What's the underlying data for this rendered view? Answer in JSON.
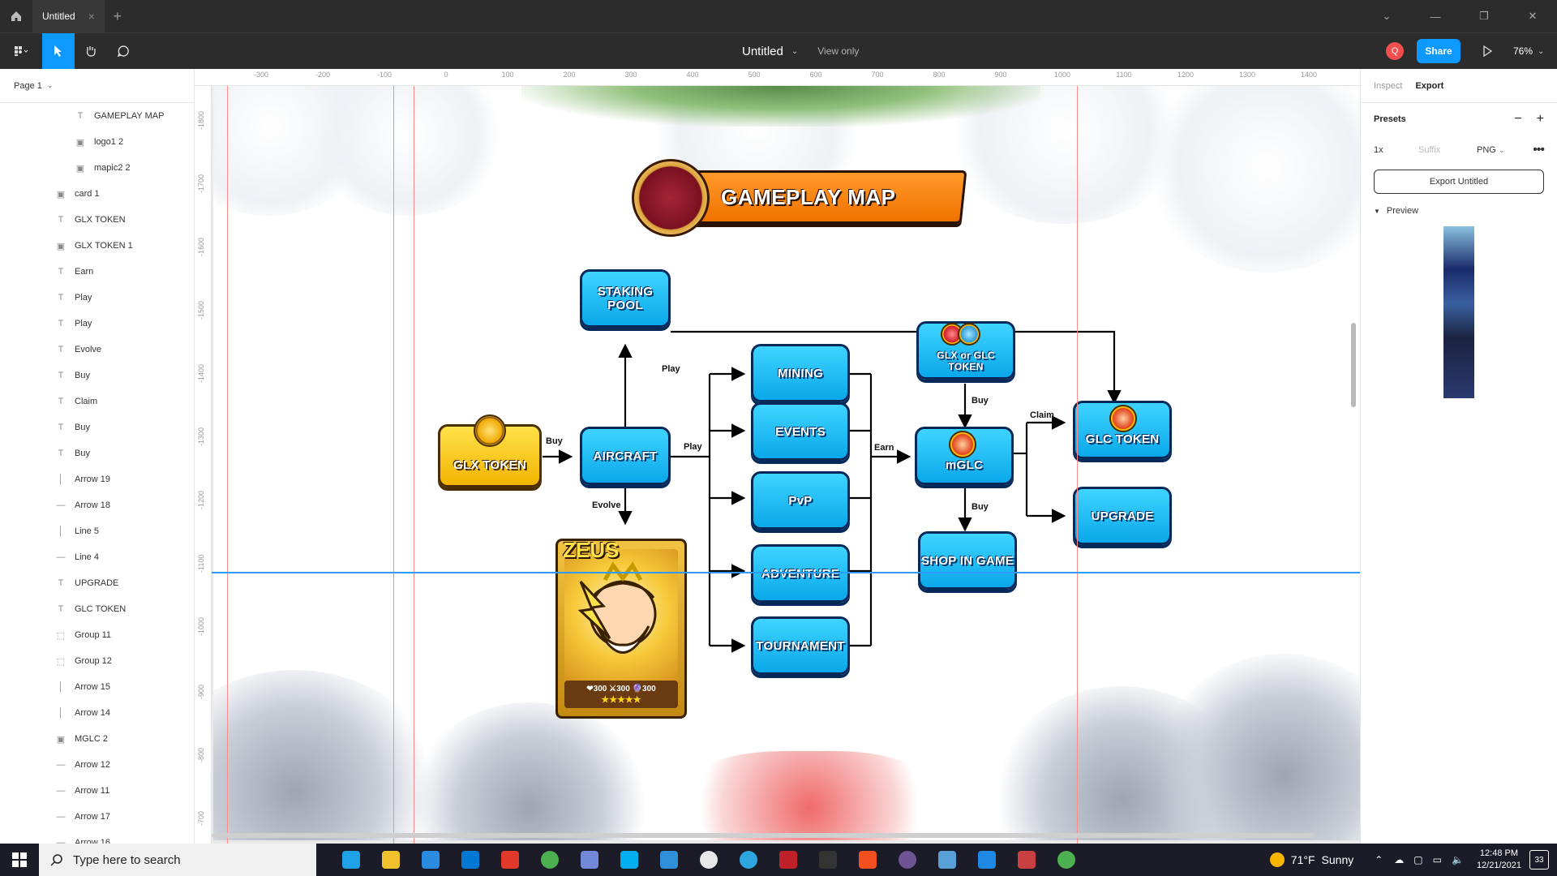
{
  "titlebar": {
    "tab_title": "Untitled",
    "tab_close": "×",
    "new_tab": "+"
  },
  "toolbar": {
    "doc_title": "Untitled",
    "view_mode": "View only",
    "avatar_initial": "Q",
    "share_label": "Share",
    "zoom_label": "76%"
  },
  "layers": {
    "page_label": "Page 1",
    "items": [
      {
        "label": "GAMEPLAY MAP",
        "icon": "text-icon",
        "indent": 2
      },
      {
        "label": "logo1 2",
        "icon": "image-icon",
        "indent": 2
      },
      {
        "label": "mapic2 2",
        "icon": "image-icon",
        "indent": 2
      },
      {
        "label": "card 1",
        "icon": "image-icon",
        "indent": 1
      },
      {
        "label": "GLX TOKEN",
        "icon": "text-icon",
        "indent": 1
      },
      {
        "label": "GLX TOKEN 1",
        "icon": "image-icon",
        "indent": 1
      },
      {
        "label": "Earn",
        "icon": "text-icon",
        "indent": 1
      },
      {
        "label": "Play",
        "icon": "text-icon",
        "indent": 1
      },
      {
        "label": "Play",
        "icon": "text-icon",
        "indent": 1
      },
      {
        "label": "Evolve",
        "icon": "text-icon",
        "indent": 1
      },
      {
        "label": "Buy",
        "icon": "text-icon",
        "indent": 1
      },
      {
        "label": "Claim",
        "icon": "text-icon",
        "indent": 1
      },
      {
        "label": "Buy",
        "icon": "text-icon",
        "indent": 1
      },
      {
        "label": "Buy",
        "icon": "text-icon",
        "indent": 1
      },
      {
        "label": "Arrow 19",
        "icon": "vline-icon",
        "indent": 1
      },
      {
        "label": "Arrow 18",
        "icon": "hline-icon",
        "indent": 1
      },
      {
        "label": "Line 5",
        "icon": "vline-icon",
        "indent": 1
      },
      {
        "label": "Line 4",
        "icon": "hline-icon",
        "indent": 1
      },
      {
        "label": "UPGRADE",
        "icon": "text-icon",
        "indent": 1
      },
      {
        "label": "GLC TOKEN",
        "icon": "text-icon",
        "indent": 1
      },
      {
        "label": "Group 11",
        "icon": "group-icon",
        "indent": 1
      },
      {
        "label": "Group 12",
        "icon": "group-icon",
        "indent": 1
      },
      {
        "label": "Arrow 15",
        "icon": "vline-icon",
        "indent": 1
      },
      {
        "label": "Arrow 14",
        "icon": "vline-icon",
        "indent": 1
      },
      {
        "label": "MGLC 2",
        "icon": "image-icon",
        "indent": 1
      },
      {
        "label": "Arrow 12",
        "icon": "hline-icon",
        "indent": 1
      },
      {
        "label": "Arrow 11",
        "icon": "hline-icon",
        "indent": 1
      },
      {
        "label": "Arrow 17",
        "icon": "hline-icon",
        "indent": 1
      },
      {
        "label": "Arrow 16",
        "icon": "hline-icon",
        "indent": 1
      }
    ]
  },
  "ruler": {
    "top_ticks": [
      "-300",
      "-200",
      "-100",
      "0",
      "100",
      "200",
      "300",
      "400",
      "500",
      "600",
      "700",
      "800",
      "900",
      "1000",
      "1100",
      "1200",
      "1300",
      "1400"
    ],
    "left_ticks": [
      "-1800",
      "-1700",
      "-1600",
      "-1500",
      "-1400",
      "-1300",
      "-1200",
      "-1100",
      "-1000",
      "-900",
      "-800",
      "-700"
    ]
  },
  "diagram": {
    "banner_title": "GAMEPLAY MAP",
    "nodes": {
      "staking_pool": "STAKING POOL",
      "glx_token": "GLX TOKEN",
      "aircraft": "AIRCRAFT",
      "mining": "MINING",
      "events": "EVENTS",
      "pvp": "PvP",
      "adventure": "ADVENTURE",
      "tournament": "TOURNAMENT",
      "glx_or_glc": "GLX or GLC TOKEN",
      "mglc": "mGLC",
      "shop": "SHOP IN GAME",
      "glc_token": "GLC TOKEN",
      "upgrade": "UPGRADE"
    },
    "edge_labels": {
      "buy1": "Buy",
      "play1": "Play",
      "play2": "Play",
      "evolve": "Evolve",
      "earn": "Earn",
      "buy2": "Buy",
      "buy3": "Buy",
      "claim": "Claim"
    },
    "card": {
      "name": "ZEUS",
      "stats": "❤300 ⚔300 🔮300",
      "stars": "★★★★★"
    }
  },
  "right_panel": {
    "tab_inspect": "Inspect",
    "tab_export": "Export",
    "presets_label": "Presets",
    "scale": "1x",
    "suffix_placeholder": "Suffix",
    "format": "PNG",
    "export_button": "Export Untitled",
    "preview_label": "Preview"
  },
  "help": "?",
  "taskbar": {
    "search_placeholder": "Type here to search",
    "weather_temp": "71°F",
    "weather_cond": "Sunny",
    "time": "12:48 PM",
    "date": "12/21/2021",
    "notifications": "33",
    "apps": [
      "edge",
      "file-explorer",
      "store",
      "mail",
      "office",
      "chrome",
      "discord",
      "skype",
      "vscode",
      "slack",
      "telegram",
      "app-red",
      "terminal",
      "figma",
      "github",
      "photos",
      "paint",
      "game",
      "chrome-2"
    ],
    "app_colors": [
      "#1fa2e8",
      "#f2c12e",
      "#2a8be0",
      "#0078d4",
      "#e23a2a",
      "#4caf50",
      "#7289da",
      "#00aff0",
      "#2f8fd8",
      "#e8e8e8",
      "#2ca5e0",
      "#c0202a",
      "#333333",
      "#f24e1e",
      "#6e5494",
      "#5aa0d8",
      "#1e88e5",
      "#c84040",
      "#4caf50"
    ]
  }
}
